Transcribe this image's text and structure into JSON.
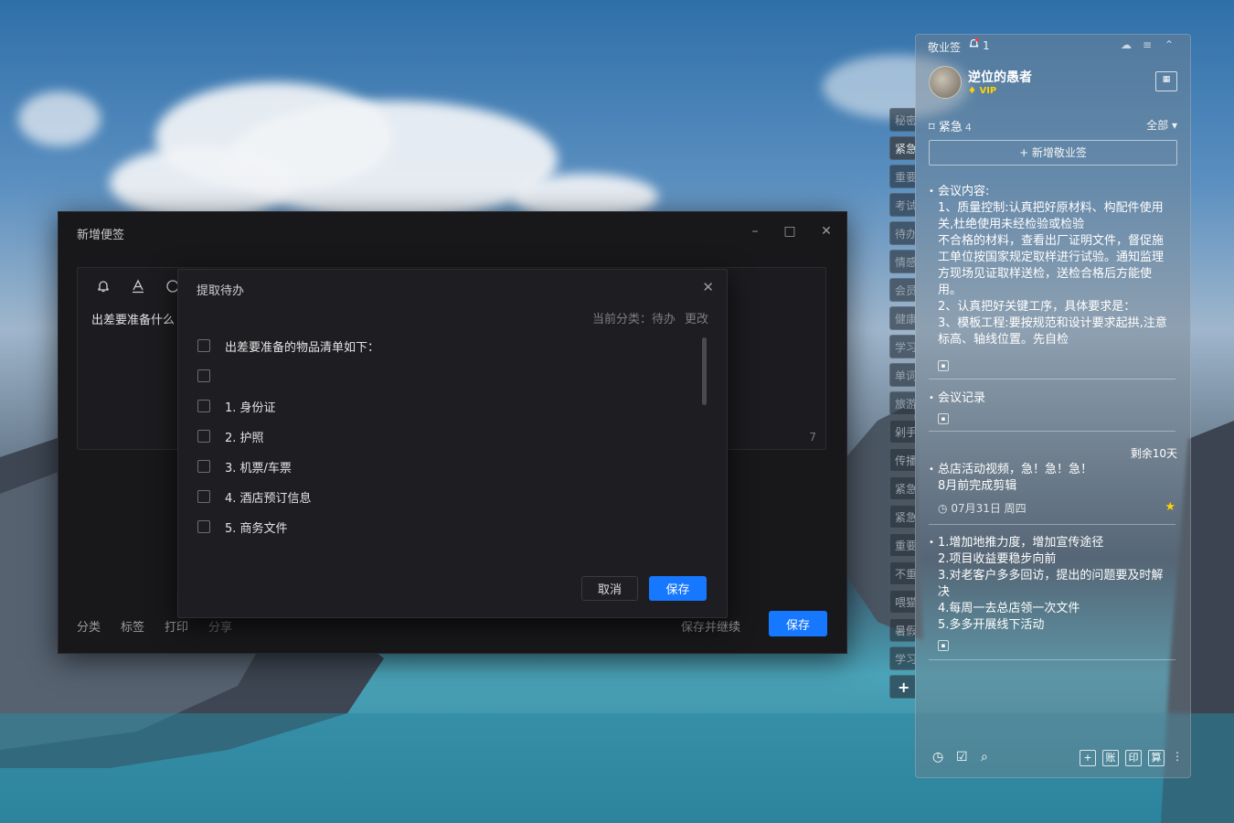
{
  "main_window": {
    "title": "新增便签",
    "controls": {
      "minimize": "–",
      "maximize": "□",
      "close": "✕"
    },
    "editor": {
      "text": "出差要准备什么",
      "char_count": "7"
    },
    "footer": {
      "category": "分类",
      "tag": "标签",
      "print": "打印",
      "share": "分享",
      "save_continue": "保存并继续",
      "save": "保存"
    }
  },
  "todo_dialog": {
    "title": "提取待办",
    "current_category_label": "当前分类：",
    "current_category_value": "待办",
    "change_label": "更改",
    "items": [
      "出差要准备的物品清单如下：",
      "",
      "1. 身份证",
      "2. 护照",
      "3. 机票/车票",
      "4. 酒店预订信息",
      "5. 商务文件"
    ],
    "cancel": "取消",
    "save": "保存"
  },
  "side_tabs": [
    "秘密",
    "紧急",
    "重要",
    "考试",
    "待办",
    "情感",
    "会员",
    "健康",
    "学习",
    "单词",
    "旅游",
    "剁手",
    "传播",
    "紧急",
    "紧急",
    "重要",
    "不重",
    "喂猫",
    "暑假",
    "学习",
    "+"
  ],
  "panel": {
    "app_name": "敬业签",
    "notification_count": "1",
    "username": "逆位的愚者",
    "vip": "VIP",
    "category": "紧急",
    "category_count": "4",
    "filter": "全部",
    "add_note": "+ 新增敬业签",
    "notes": [
      {
        "lines": [
          "会议内容:",
          "1、质量控制:认真把好原材料、构配件使用",
          "关,杜绝使用未经检验或检验",
          "不合格的材料，查看出厂证明文件，督促施",
          "工单位按国家规定取样进行试验。通知监理",
          "方现场见证取样送检，送检合格后方能使",
          "用。",
          "2、认真把好关键工序，具体要求是：",
          "3、模板工程:要按规范和设计要求起拱,注意",
          "标高、轴线位置。先自检"
        ]
      },
      {
        "lines": [
          "会议记录"
        ]
      },
      {
        "remain": "剩余10天",
        "lines": [
          "总店活动视频，急！急！急！",
          "8月前完成剪辑"
        ],
        "date": "07月31日 周四"
      },
      {
        "lines": [
          "1.增加地推力度，增加宣传途径",
          "2.项目收益要稳步向前",
          "3.对老客户多多回访，提出的问题要及时解",
          "决",
          "4.每周一去总店领一次文件",
          "5.多多开展线下活动"
        ]
      }
    ],
    "bottom_boxes": [
      "+",
      "账",
      "印",
      "算"
    ]
  }
}
